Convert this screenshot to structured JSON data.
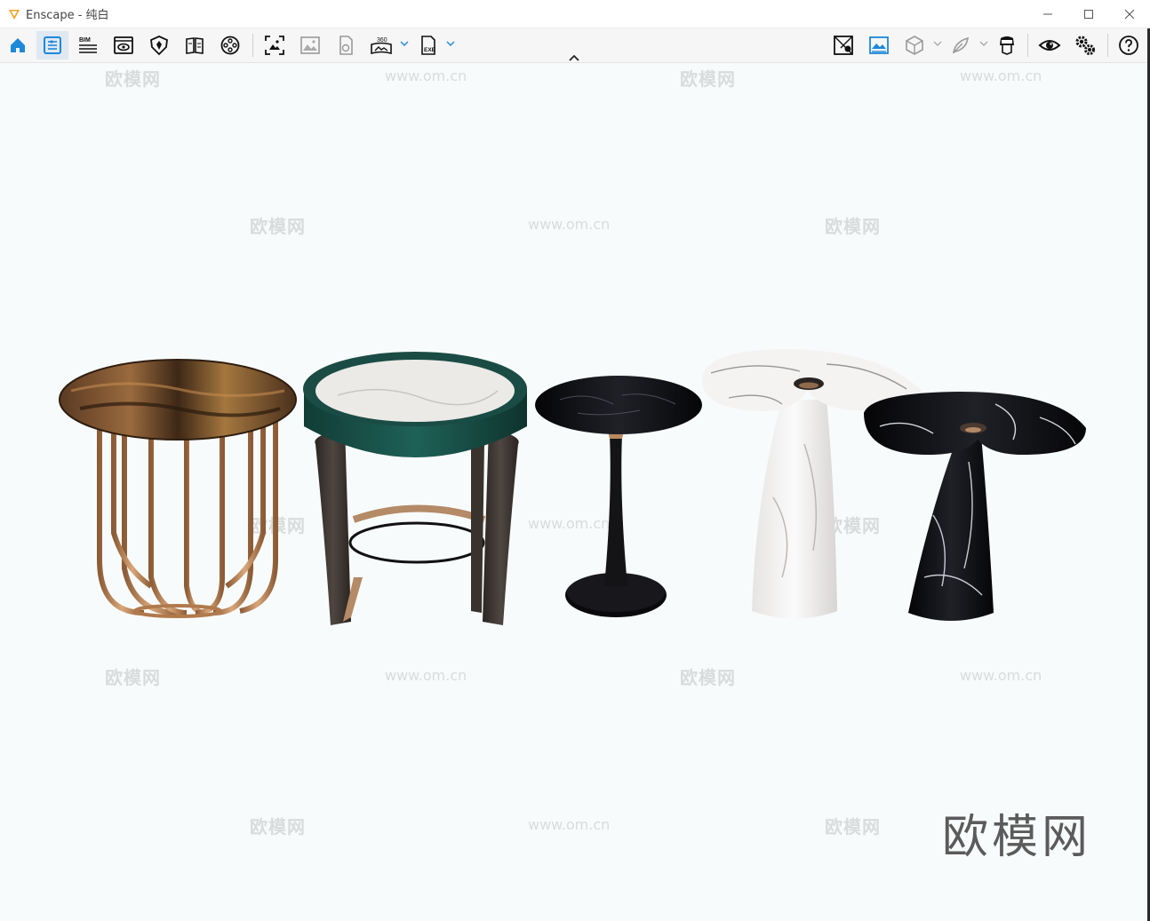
{
  "window": {
    "title": "Enscape - 纯白",
    "controls": [
      "minimize-icon",
      "maximize-icon",
      "close-icon"
    ]
  },
  "toolbar": {
    "left_tools": [
      {
        "name": "home-icon"
      },
      {
        "name": "visual-settings-icon"
      },
      {
        "name": "bim-icon",
        "label": "BIM"
      },
      {
        "name": "view-management-icon"
      },
      {
        "name": "material-shield-icon"
      },
      {
        "name": "asset-library-icon"
      },
      {
        "name": "video-reel-icon"
      },
      {
        "name": "screenshot-icon"
      },
      {
        "name": "render-image-icon"
      },
      {
        "name": "export-file-icon"
      },
      {
        "name": "panorama-360-icon",
        "label": "360"
      },
      {
        "name": "exe-export-icon",
        "label": "EXE"
      }
    ],
    "right_tools": [
      {
        "name": "map-icon"
      },
      {
        "name": "skyline-image-icon"
      },
      {
        "name": "box-view-icon"
      },
      {
        "name": "feather-icon"
      },
      {
        "name": "vr-headset-icon"
      },
      {
        "name": "eye-icon"
      },
      {
        "name": "settings-gears-icon"
      },
      {
        "name": "help-icon"
      }
    ],
    "active_tool": "visual-settings-icon"
  },
  "watermark": {
    "text": "欧模网",
    "url": "www.om.cn",
    "brand": "欧模网"
  },
  "colors": {
    "accent": "#1e88d9",
    "background": "#f8fbfb"
  }
}
